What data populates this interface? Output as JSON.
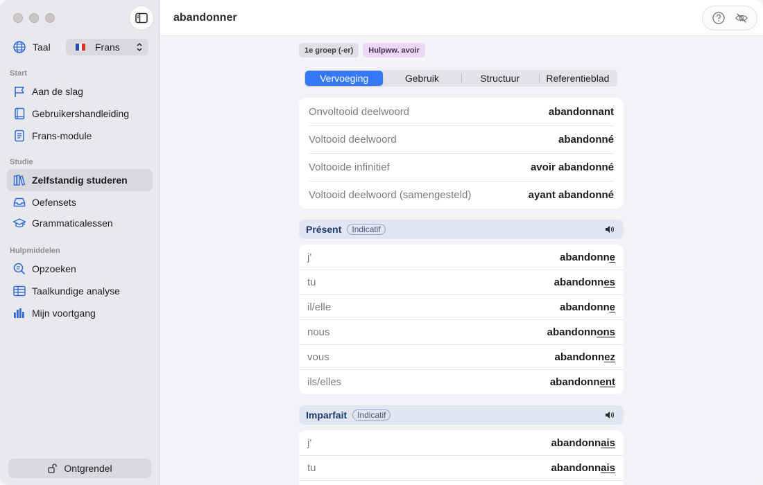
{
  "window": {
    "title": "abandonner"
  },
  "sidebar": {
    "language_label": "Taal",
    "language_value": "Frans",
    "sections": [
      {
        "label": "Start"
      },
      {
        "label": "Studie"
      },
      {
        "label": "Hulpmiddelen"
      }
    ],
    "items": [
      {
        "label": "Aan de slag",
        "icon": "flag-icon"
      },
      {
        "label": "Gebruikershandleiding",
        "icon": "book-icon"
      },
      {
        "label": "Frans-module",
        "icon": "document-icon"
      },
      {
        "label": "Zelfstandig studeren",
        "icon": "books-icon",
        "active": true
      },
      {
        "label": "Oefensets",
        "icon": "tray-icon"
      },
      {
        "label": "Grammaticalessen",
        "icon": "graduation-cap-icon"
      },
      {
        "label": "Opzoeken",
        "icon": "magnifier-icon"
      },
      {
        "label": "Taalkundige analyse",
        "icon": "table-icon"
      },
      {
        "label": "Mijn voortgang",
        "icon": "bar-chart-icon"
      }
    ],
    "unlock_label": "Ontgrendel"
  },
  "badges": [
    {
      "label": "1e groep (-er)"
    },
    {
      "label": "Hulpww. avoir"
    }
  ],
  "tabs": [
    {
      "label": "Vervoeging",
      "active": true
    },
    {
      "label": "Gebruik"
    },
    {
      "label": "Structuur"
    },
    {
      "label": "Referentieblad"
    }
  ],
  "forms": [
    {
      "label": "Onvoltooid deelwoord",
      "value": "abandonnant"
    },
    {
      "label": "Voltooid deelwoord",
      "value": "abandonné"
    },
    {
      "label": "Voltooide infinitief",
      "value": "avoir abandonné"
    },
    {
      "label": "Voltooid deelwoord (samengesteld)",
      "value": "ayant abandonné"
    }
  ],
  "tenses": [
    {
      "name": "Présent",
      "mood": "Indicatif",
      "rows": [
        {
          "pronoun": "j'",
          "stem": "abandonn",
          "ending": "e"
        },
        {
          "pronoun": "tu",
          "stem": "abandonn",
          "ending": "es"
        },
        {
          "pronoun": "il/elle",
          "stem": "abandonn",
          "ending": "e"
        },
        {
          "pronoun": "nous",
          "stem": "abandonn",
          "ending": "ons"
        },
        {
          "pronoun": "vous",
          "stem": "abandonn",
          "ending": "ez"
        },
        {
          "pronoun": "ils/elles",
          "stem": "abandonn",
          "ending": "ent"
        }
      ]
    },
    {
      "name": "Imparfait",
      "mood": "Indicatif",
      "rows": [
        {
          "pronoun": "j'",
          "stem": "abandonn",
          "ending": "ais"
        },
        {
          "pronoun": "tu",
          "stem": "abandonn",
          "ending": "ais"
        }
      ]
    }
  ],
  "colors": {
    "accent": "#3478f6",
    "tense_header_bg": "#e1e6f2",
    "badge_purple": "#ecd8f4"
  }
}
